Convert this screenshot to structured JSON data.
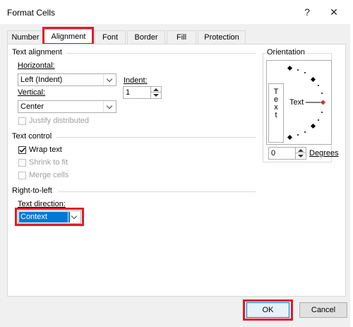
{
  "dialog": {
    "title": "Format Cells",
    "help_glyph": "?",
    "close_glyph": "✕"
  },
  "tabs": [
    {
      "label": "Number",
      "active": false
    },
    {
      "label": "Alignment",
      "active": true
    },
    {
      "label": "Font",
      "active": false
    },
    {
      "label": "Border",
      "active": false
    },
    {
      "label": "Fill",
      "active": false
    },
    {
      "label": "Protection",
      "active": false
    }
  ],
  "text_alignment": {
    "group_title": "Text alignment",
    "horizontal_label": "Horizontal:",
    "horizontal_value": "Left (Indent)",
    "indent_label": "Indent:",
    "indent_value": "1",
    "vertical_label": "Vertical:",
    "vertical_value": "Center",
    "justify_distributed": "Justify distributed"
  },
  "text_control": {
    "group_title": "Text control",
    "wrap_text": "Wrap text",
    "wrap_text_checked": true,
    "shrink_to_fit": "Shrink to fit",
    "merge_cells": "Merge cells"
  },
  "right_to_left": {
    "group_title": "Right-to-left",
    "text_direction_label": "Text direction:",
    "text_direction_value": "Context"
  },
  "orientation": {
    "group_title": "Orientation",
    "vertical_letters": [
      "T",
      "e",
      "x",
      "t"
    ],
    "dial_text": "Text",
    "degrees_value": "0",
    "degrees_label": "Degrees"
  },
  "buttons": {
    "ok": "OK",
    "cancel": "Cancel"
  },
  "colors": {
    "highlight": "#e01b2a",
    "selection": "#0078d7",
    "accent_marker": "#c0392b"
  }
}
